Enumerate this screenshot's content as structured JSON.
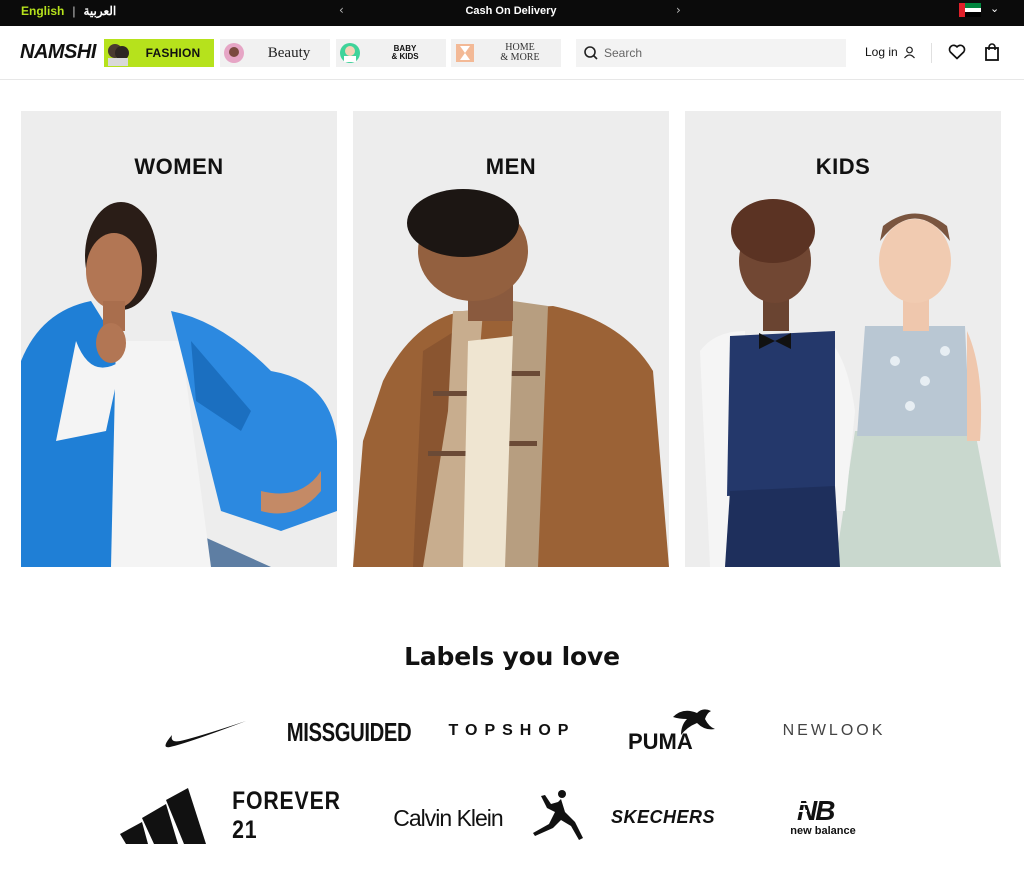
{
  "topbar": {
    "lang_en": "English",
    "separator": "|",
    "lang_ar": "العربية",
    "prev_arrow": "‹",
    "next_arrow": "›",
    "announcement": "Cash On Delivery",
    "country_chevron": "⌄",
    "flag_colors": {
      "red": "#e0202a",
      "green": "#00843d",
      "white": "#ffffff",
      "black": "#000000"
    }
  },
  "header": {
    "logo": "NAMSHI",
    "categories": [
      {
        "label": "FASHION",
        "bg": "#b6e21c"
      },
      {
        "label": "Beauty",
        "bg": "#f1f1f1"
      },
      {
        "label": "BABY\n& KIDS",
        "bg": "#f1f1f1"
      },
      {
        "label": "HOME\n& MORE",
        "bg": "#f1f1f1"
      }
    ],
    "search": {
      "placeholder": "Search",
      "icon": "search-icon"
    },
    "login_label": "Log in",
    "icons": [
      "user-icon",
      "heart-icon",
      "bag-icon"
    ]
  },
  "tiles": [
    {
      "title": "WOMEN"
    },
    {
      "title": "MEN"
    },
    {
      "title": "KIDS"
    }
  ],
  "labels": {
    "title": "Labels you love",
    "brands": [
      "Nike",
      "MISSGUIDED",
      "TOPSHOP",
      "PUMA",
      "NEWLOOK",
      "adidas",
      "FOREVER 21",
      "Calvin Klein",
      "Jordan",
      "SKECHERS",
      "new balance"
    ]
  },
  "colors": {
    "accent": "#b6e21c",
    "topbar_bg": "#0b0b0b",
    "tile_bg": "#ededed"
  }
}
